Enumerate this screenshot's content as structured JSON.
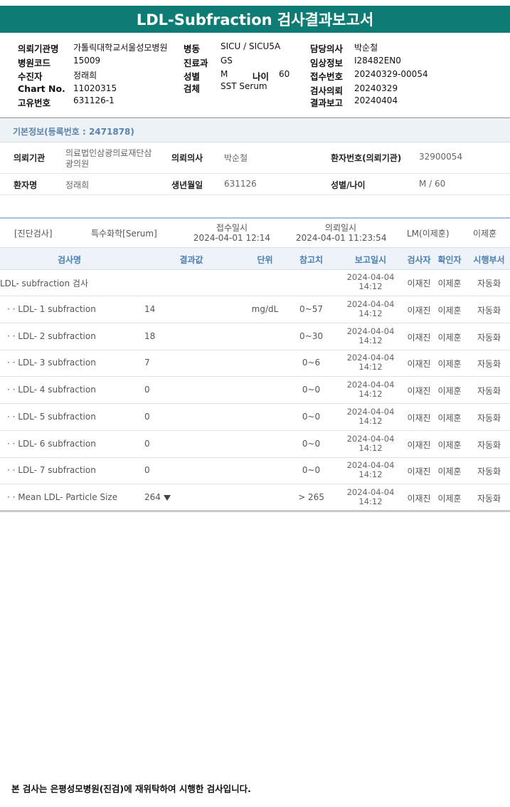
{
  "report_title": "LDL-Subfraction 검사결과보고서",
  "header": {
    "institution_label": "의뢰기관명",
    "institution": "가톨릭대학교서울성모병원",
    "ward_label": "병동",
    "ward": "SICU / SICU5A",
    "doctor_label": "담당의사",
    "doctor": "박순철",
    "hospital_code_label": "병원코드",
    "hospital_code": "15009",
    "dept_label": "진료과",
    "dept": "GS",
    "clinical_info_label": "임상정보",
    "clinical_info": "I28482EN0",
    "patient_label": "수진자",
    "patient": "정래희",
    "sex_label": "성별",
    "sex": "M",
    "age_label": "나이",
    "age": "60",
    "receipt_no_label": "접수번호",
    "receipt_no": "20240329-00054",
    "chart_label": "Chart No.",
    "chart_no": "11020315",
    "specimen_label": "검체",
    "specimen": "SST Serum",
    "test_request_label": "검사의뢰",
    "test_request": "20240329",
    "unique_no_label": "고유번호",
    "unique_no": "631126-1",
    "result_report_label": "결과보고",
    "result_report": "20240404"
  },
  "basic_info": {
    "section_title": "기본정보(등록번호 : 2471878)",
    "requesting_org_label": "의뢰기관",
    "requesting_org_line1": "의료법인삼광의료재단삼",
    "requesting_org_line2": "광의원",
    "requesting_doctor_label": "의뢰의사",
    "requesting_doctor": "박순철",
    "patient_no_label": "환자번호(의뢰기관)",
    "patient_no": "32900054",
    "patient_name_label": "환자명",
    "patient_name": "정래희",
    "birth_label": "생년월일",
    "birth": "631126",
    "sex_age_label": "성별/나이",
    "sex_age": "M / 60"
  },
  "meta": {
    "category": "[진단검사]",
    "subcategory": "특수화학[Serum]",
    "received_label": "접수일시",
    "received": "2024-04-01 12:14",
    "requested_label": "의뢰일시",
    "requested": "2024-04-01 11:23:54",
    "lm": "LM(이제훈)",
    "staff": "이제훈"
  },
  "table": {
    "headers": {
      "test": "검사명",
      "result": "결과값",
      "unit": "단위",
      "ref": "참고치",
      "report_date": "보고일시",
      "tester": "검사자",
      "checker": "확인자",
      "dept": "시행부서"
    },
    "rows": [
      {
        "name": "LDL- subfraction 검사",
        "result": "",
        "unit": "",
        "ref": "",
        "date": "2024-04-04",
        "time": "14:12",
        "tester": "이재진",
        "checker": "이제훈",
        "dept": "자동화"
      },
      {
        "name": "· · LDL- 1 subfraction",
        "result": "14",
        "unit": "mg/dL",
        "ref": "0~57",
        "date": "2024-04-04",
        "time": "14:12",
        "tester": "이재진",
        "checker": "이제훈",
        "dept": "자동화"
      },
      {
        "name": "· · LDL- 2 subfraction",
        "result": "18",
        "unit": "",
        "ref": "0~30",
        "date": "2024-04-04",
        "time": "14:12",
        "tester": "이재진",
        "checker": "이제훈",
        "dept": "자동화"
      },
      {
        "name": "· · LDL- 3 subfraction",
        "result": "7",
        "unit": "",
        "ref": "0~6",
        "date": "2024-04-04",
        "time": "14:12",
        "tester": "이재진",
        "checker": "이제훈",
        "dept": "자동화"
      },
      {
        "name": "· · LDL- 4 subfraction",
        "result": "0",
        "unit": "",
        "ref": "0~0",
        "date": "2024-04-04",
        "time": "14:12",
        "tester": "이재진",
        "checker": "이제훈",
        "dept": "자동화"
      },
      {
        "name": "· · LDL- 5 subfraction",
        "result": "0",
        "unit": "",
        "ref": "0~0",
        "date": "2024-04-04",
        "time": "14:12",
        "tester": "이재진",
        "checker": "이제훈",
        "dept": "자동화"
      },
      {
        "name": "· · LDL- 6 subfraction",
        "result": "0",
        "unit": "",
        "ref": "0~0",
        "date": "2024-04-04",
        "time": "14:12",
        "tester": "이재진",
        "checker": "이제훈",
        "dept": "자동화"
      },
      {
        "name": "· · LDL- 7 subfraction",
        "result": "0",
        "unit": "",
        "ref": "0~0",
        "date": "2024-04-04",
        "time": "14:12",
        "tester": "이재진",
        "checker": "이제훈",
        "dept": "자동화"
      },
      {
        "name": "· · Mean LDL- Particle Size",
        "result": "264",
        "flag": "down-arrow-icon",
        "unit": "",
        "ref": "> 265",
        "date": "2024-04-04",
        "time": "14:12",
        "tester": "이재진",
        "checker": "이제훈",
        "dept": "자동화"
      }
    ]
  },
  "footer_note": "본 검사는 은평성모병원(진검)에 재위탁하여 시행한 검사입니다.",
  "colors": {
    "title_bar": "#0e7c74",
    "section_title_text": "#5a84ad",
    "header_text": "#4a7fb5"
  }
}
